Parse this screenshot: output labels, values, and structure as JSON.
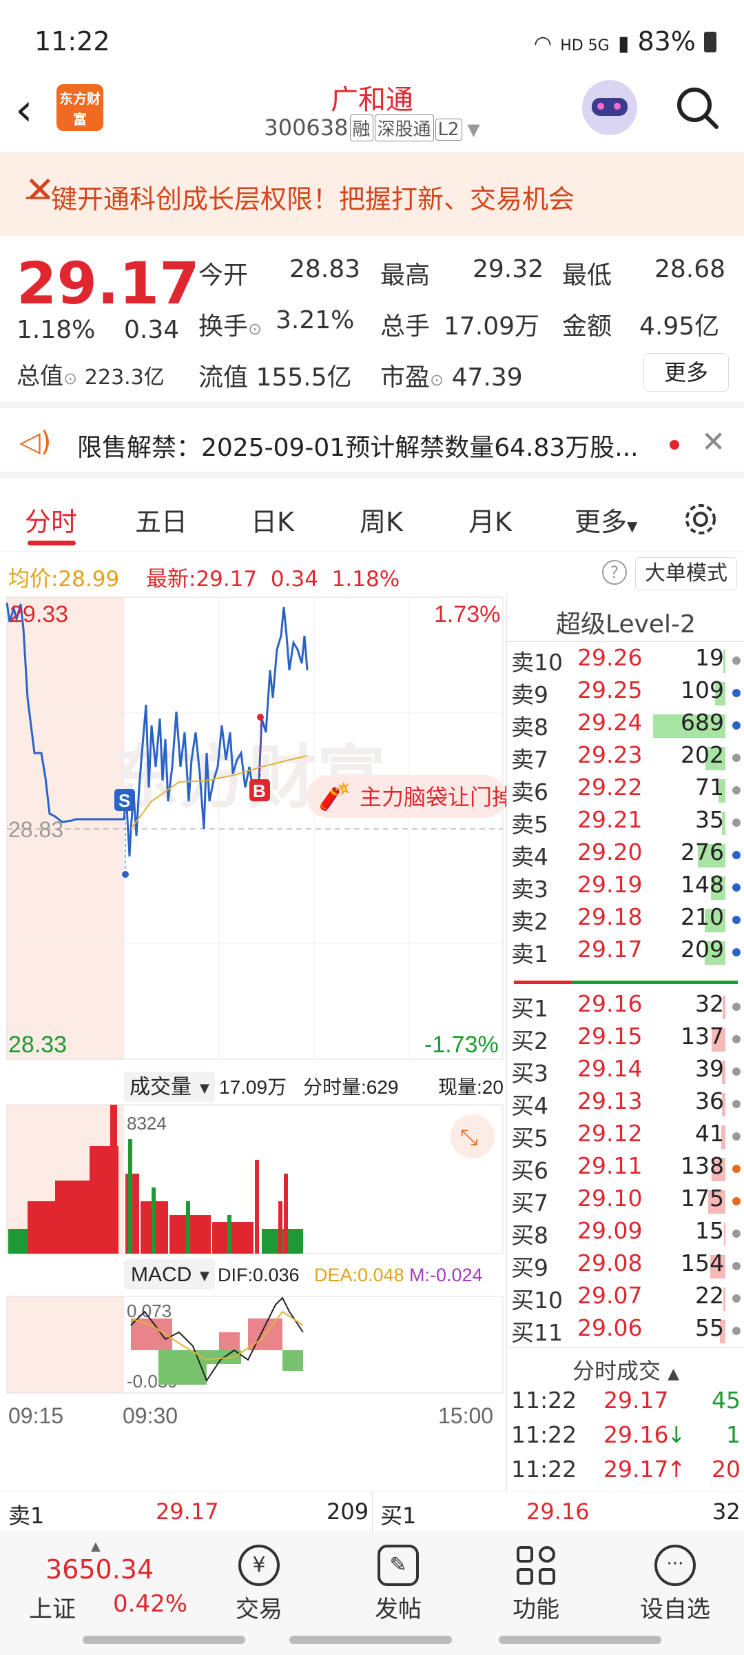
{
  "status": {
    "time": "11:22",
    "battery": "83%",
    "net": "HD 5G"
  },
  "header": {
    "back": "‹",
    "logo": "东方财富",
    "title": "广和通",
    "code": "300638",
    "tags": [
      "融",
      "深股通",
      "L2"
    ]
  },
  "banner": {
    "text": "一键开通科创成长层权限！把握打新、交易机会",
    "close": "✕"
  },
  "quote": {
    "price": "29.17",
    "pct": "1.18%",
    "chg": "0.34",
    "jk_l": "今开",
    "jk": "28.83",
    "zg_l": "最高",
    "zg": "29.32",
    "zd_l": "最低",
    "zd": "28.68",
    "hs_l": "换手",
    "hs": "3.21%",
    "zs_l": "总手",
    "zs": "17.09万",
    "je_l": "金额",
    "je": "4.95亿",
    "zz_l": "总值",
    "zz": "223.3亿",
    "lz_l": "流值",
    "lz": "155.5亿",
    "sy_l": "市盈",
    "sy": "47.39",
    "more": "更多"
  },
  "notice": {
    "text": "限售解禁：2025-09-01预计解禁数量64.83万股..."
  },
  "tabs": [
    "分时",
    "五日",
    "日K",
    "周K",
    "月K",
    "更多"
  ],
  "avg": {
    "avg_l": "均价:",
    "avg": "28.99",
    "last_l": "最新:",
    "last": "29.17",
    "chg": "0.34",
    "pct": "1.18%",
    "mode": "大单模式"
  },
  "chart": {
    "high": "29.33",
    "low": "28.33",
    "pre": "28.83",
    "up": "1.73%",
    "down": "-1.73%",
    "watermark": "东方财富",
    "signal": "主力脑袋让门掉",
    "s": "S",
    "b": "B",
    "vol_l": "成交量",
    "vol": "17.09万",
    "fs_l": "分时量:629",
    "xl_l": "现量:20",
    "vol_max": "8324",
    "macd_l": "MACD",
    "dif": "DIF:0.036",
    "dea": "DEA:0.048",
    "m": "M:-0.024",
    "macd_hi": "0.073",
    "macd_lo": "-0.039",
    "t_start": "09:15",
    "t_mid": "09:30",
    "t_end": "15:00"
  },
  "l2": {
    "title": "超级Level-2",
    "asks": [
      {
        "l": "卖10",
        "p": "29.26",
        "q": "19",
        "w": 3,
        "c": "#999"
      },
      {
        "l": "卖9",
        "p": "29.25",
        "q": "109",
        "w": 14,
        "c": "#2a63c7"
      },
      {
        "l": "卖8",
        "p": "29.24",
        "q": "689",
        "w": 100,
        "c": "#2a63c7"
      },
      {
        "l": "卖7",
        "p": "29.23",
        "q": "202",
        "w": 28,
        "c": "#999"
      },
      {
        "l": "卖6",
        "p": "29.22",
        "q": "71",
        "w": 10,
        "c": "#999"
      },
      {
        "l": "卖5",
        "p": "29.21",
        "q": "35",
        "w": 5,
        "c": "#999"
      },
      {
        "l": "卖4",
        "p": "29.20",
        "q": "276",
        "w": 38,
        "c": "#2a63c7"
      },
      {
        "l": "卖3",
        "p": "29.19",
        "q": "148",
        "w": 20,
        "c": "#2a63c7"
      },
      {
        "l": "卖2",
        "p": "29.18",
        "q": "210",
        "w": 29,
        "c": "#2a63c7"
      },
      {
        "l": "卖1",
        "p": "29.17",
        "q": "209",
        "w": 29,
        "c": "#2a63c7"
      }
    ],
    "bids": [
      {
        "l": "买1",
        "p": "29.16",
        "q": "32",
        "w": 4,
        "c": "#999"
      },
      {
        "l": "买2",
        "p": "29.15",
        "q": "137",
        "w": 19,
        "c": "#999"
      },
      {
        "l": "买3",
        "p": "29.14",
        "q": "39",
        "w": 5,
        "c": "#999"
      },
      {
        "l": "买4",
        "p": "29.13",
        "q": "36",
        "w": 5,
        "c": "#999"
      },
      {
        "l": "买5",
        "p": "29.12",
        "q": "41",
        "w": 6,
        "c": "#999"
      },
      {
        "l": "买6",
        "p": "29.11",
        "q": "138",
        "w": 19,
        "c": "#e86c1c"
      },
      {
        "l": "买7",
        "p": "29.10",
        "q": "175",
        "w": 24,
        "c": "#e86c1c"
      },
      {
        "l": "买8",
        "p": "29.09",
        "q": "15",
        "w": 2,
        "c": "#999"
      },
      {
        "l": "买9",
        "p": "29.08",
        "q": "154",
        "w": 21,
        "c": "#999"
      },
      {
        "l": "买10",
        "p": "29.07",
        "q": "22",
        "w": 3,
        "c": "#999"
      },
      {
        "l": "买11",
        "p": "29.06",
        "q": "55",
        "w": 8,
        "c": "#999"
      }
    ],
    "ticks_l": "分时成交",
    "ticks": [
      {
        "t": "11:22",
        "p": "29.17",
        "a": "",
        "v": "45",
        "vc": "#1d9a33"
      },
      {
        "t": "11:22",
        "p": "29.16",
        "a": "↓",
        "v": "1",
        "vc": "#1d9a33"
      },
      {
        "t": "11:22",
        "p": "29.17",
        "a": "↑",
        "v": "20",
        "vc": "#e0272f"
      }
    ]
  },
  "bottom": {
    "sell_l": "卖1",
    "sell_p": "29.17",
    "sell_q": "209",
    "buy_l": "买1",
    "buy_p": "29.16",
    "buy_q": "32"
  },
  "nav": {
    "index": "3650.34",
    "index_l": "上证",
    "index_pct": "0.42%",
    "items": [
      "交易",
      "发帖",
      "功能",
      "设自选"
    ]
  }
}
